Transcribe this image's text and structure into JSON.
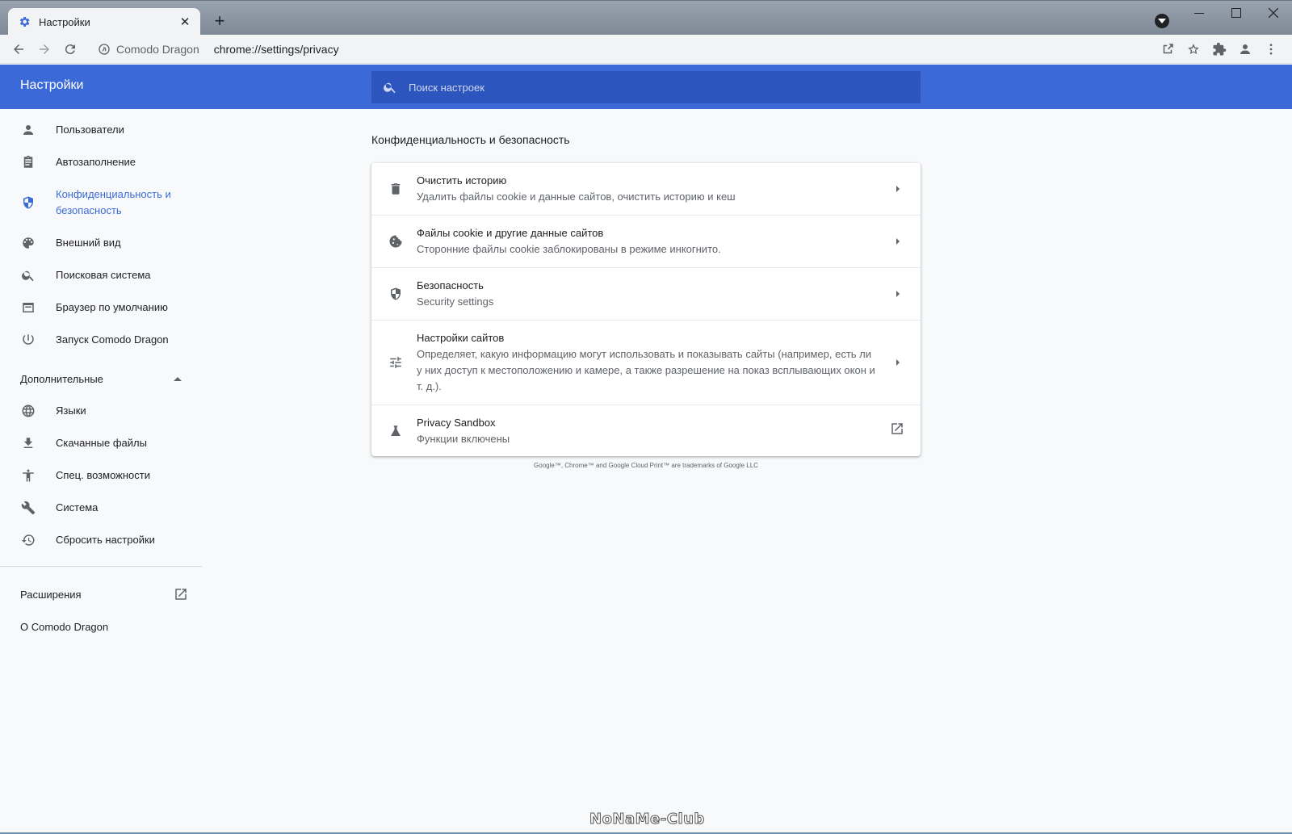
{
  "window": {
    "tab_title": "Настройки",
    "tab_close": "✕",
    "new_tab": "+"
  },
  "toolbar": {
    "site_name": "Comodo Dragon",
    "url": "chrome://settings/privacy"
  },
  "header": {
    "title": "Настройки",
    "search_placeholder": "Поиск настроек"
  },
  "sidebar": {
    "items": [
      {
        "label": "Пользователи",
        "icon": "person-icon"
      },
      {
        "label": "Автозаполнение",
        "icon": "clipboard-icon"
      },
      {
        "label": "Конфиденциальность и безопасность",
        "icon": "shield-icon",
        "active": true
      },
      {
        "label": "Внешний вид",
        "icon": "palette-icon"
      },
      {
        "label": "Поисковая система",
        "icon": "search-icon"
      },
      {
        "label": "Браузер по умолчанию",
        "icon": "browser-icon"
      },
      {
        "label": "Запуск Comodo Dragon",
        "icon": "power-icon"
      }
    ],
    "advanced_label": "Дополнительные",
    "advanced_items": [
      {
        "label": "Языки",
        "icon": "globe-icon"
      },
      {
        "label": "Скачанные файлы",
        "icon": "download-icon"
      },
      {
        "label": "Спец. возможности",
        "icon": "accessibility-icon"
      },
      {
        "label": "Система",
        "icon": "wrench-icon"
      },
      {
        "label": "Сбросить настройки",
        "icon": "restore-icon"
      }
    ],
    "extensions_label": "Расширения",
    "about_label": "О Comodo Dragon"
  },
  "main": {
    "section_title": "Конфиденциальность и безопасность",
    "rows": [
      {
        "title": "Очистить историю",
        "subtitle": "Удалить файлы cookie и данные сайтов, очистить историю и кеш",
        "icon": "trash-icon"
      },
      {
        "title": "Файлы cookie и другие данные сайтов",
        "subtitle": "Сторонние файлы cookie заблокированы в режиме инкогнито.",
        "icon": "cookie-icon"
      },
      {
        "title": "Безопасность",
        "subtitle": "Security settings",
        "icon": "security-shield-icon"
      },
      {
        "title": "Настройки сайтов",
        "subtitle": "Определяет, какую информацию могут использовать и показывать сайты (например, есть ли у них доступ к местоположению и камере, а также разрешение на показ всплывающих окон и т. д.).",
        "icon": "tune-icon"
      },
      {
        "title": "Privacy Sandbox",
        "subtitle": "Функции включены",
        "icon": "flask-icon"
      }
    ],
    "trademark": "Google™, Chrome™ and Google Cloud Print™ are trademarks of Google LLC"
  },
  "watermark": "NoNaMe-Club",
  "colors": {
    "accent": "#3b6ad8",
    "search_bg": "#2c55bd",
    "page_bg": "#f8f9fa"
  }
}
